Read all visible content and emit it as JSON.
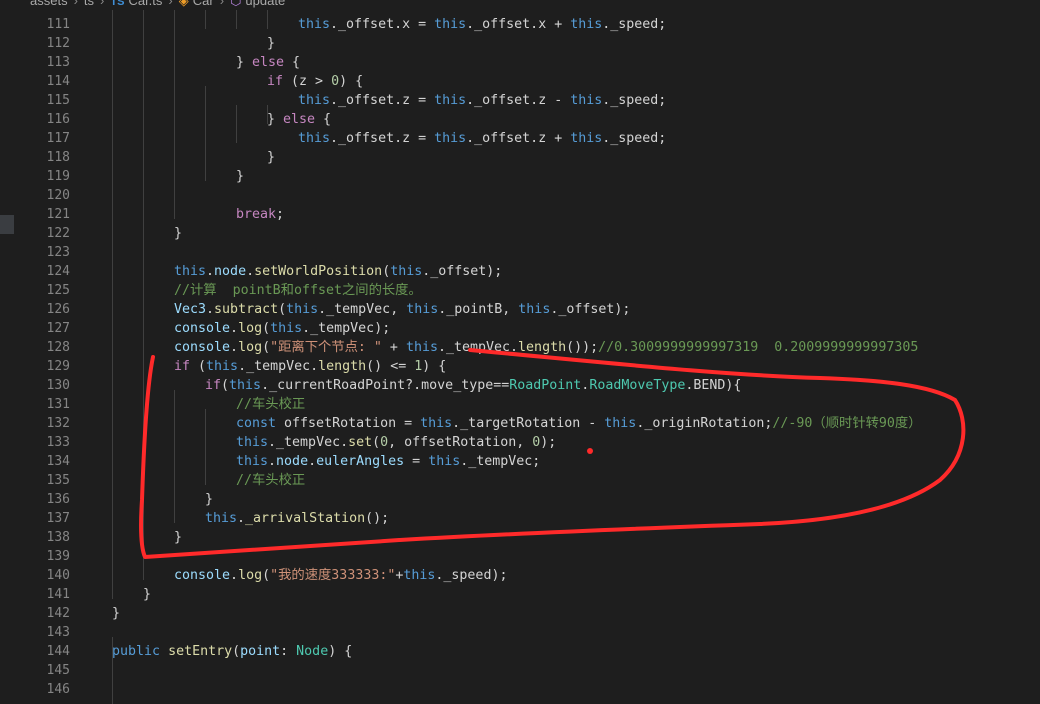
{
  "breadcrumb": {
    "items": [
      "assets",
      "ts",
      "Car.ts",
      "Car",
      "update"
    ],
    "file_badge": "TS"
  },
  "line_numbers": [
    "111",
    "112",
    "113",
    "114",
    "115",
    "116",
    "117",
    "118",
    "119",
    "120",
    "121",
    "122",
    "123",
    "124",
    "125",
    "126",
    "127",
    "128",
    "129",
    "130",
    "131",
    "132",
    "133",
    "134",
    "135",
    "136",
    "137",
    "138",
    "139",
    "140",
    "141",
    "142",
    "143",
    "144",
    "145",
    "146"
  ],
  "code_lines": [
    [
      [
        "p",
        "this"
      ],
      [
        "t",
        "._offset.x = "
      ],
      [
        "p",
        "this"
      ],
      [
        "t",
        "._offset.x + "
      ],
      [
        "p",
        "this"
      ],
      [
        "t",
        "._speed;"
      ]
    ],
    [
      [
        "t",
        "}"
      ]
    ],
    [
      [
        "t",
        "} "
      ],
      [
        "c",
        "else"
      ],
      [
        "t",
        " {"
      ]
    ],
    [
      [
        "c",
        "if"
      ],
      [
        "t",
        " (z > "
      ],
      [
        "n",
        "0"
      ],
      [
        "t",
        ") {"
      ]
    ],
    [
      [
        "p",
        "this"
      ],
      [
        "t",
        "._offset.z = "
      ],
      [
        "p",
        "this"
      ],
      [
        "t",
        "._offset.z - "
      ],
      [
        "p",
        "this"
      ],
      [
        "t",
        "._speed;"
      ]
    ],
    [
      [
        "t",
        "} "
      ],
      [
        "c",
        "else"
      ],
      [
        "t",
        " {"
      ]
    ],
    [
      [
        "p",
        "this"
      ],
      [
        "t",
        "._offset.z = "
      ],
      [
        "p",
        "this"
      ],
      [
        "t",
        "._offset.z + "
      ],
      [
        "p",
        "this"
      ],
      [
        "t",
        "._speed;"
      ]
    ],
    [
      [
        "t",
        "}"
      ]
    ],
    [
      [
        "t",
        "}"
      ]
    ],
    [],
    [
      [
        "c",
        "break"
      ],
      [
        "t",
        ";"
      ]
    ],
    [
      [
        "t",
        "}"
      ]
    ],
    [],
    [
      [
        "p",
        "this"
      ],
      [
        "t",
        "."
      ],
      [
        "v",
        "node"
      ],
      [
        "t",
        "."
      ],
      [
        "f",
        "setWorldPosition"
      ],
      [
        "t",
        "("
      ],
      [
        "p",
        "this"
      ],
      [
        "t",
        "._offset);"
      ]
    ],
    [
      [
        "m",
        "//计算  pointB和offset之间的长度。"
      ]
    ],
    [
      [
        "v",
        "Vec3"
      ],
      [
        "t",
        "."
      ],
      [
        "f",
        "subtract"
      ],
      [
        "t",
        "("
      ],
      [
        "p",
        "this"
      ],
      [
        "t",
        "._tempVec, "
      ],
      [
        "p",
        "this"
      ],
      [
        "t",
        "._pointB, "
      ],
      [
        "p",
        "this"
      ],
      [
        "t",
        "._offset);"
      ]
    ],
    [
      [
        "v",
        "console"
      ],
      [
        "t",
        "."
      ],
      [
        "f",
        "log"
      ],
      [
        "t",
        "("
      ],
      [
        "p",
        "this"
      ],
      [
        "t",
        "._tempVec);"
      ]
    ],
    [
      [
        "v",
        "console"
      ],
      [
        "t",
        "."
      ],
      [
        "f",
        "log"
      ],
      [
        "t",
        "("
      ],
      [
        "s",
        "\"距离下个节点: \""
      ],
      [
        "t",
        " + "
      ],
      [
        "p",
        "this"
      ],
      [
        "t",
        "._tempVec."
      ],
      [
        "f",
        "length"
      ],
      [
        "t",
        "());"
      ],
      [
        "m",
        "//0.3009999999997319  0.2009999999997305"
      ]
    ],
    [
      [
        "c",
        "if"
      ],
      [
        "t",
        " ("
      ],
      [
        "p",
        "this"
      ],
      [
        "t",
        "._tempVec."
      ],
      [
        "f",
        "length"
      ],
      [
        "t",
        "() <= "
      ],
      [
        "n",
        "1"
      ],
      [
        "t",
        ") {"
      ]
    ],
    [
      [
        "c",
        "if"
      ],
      [
        "t",
        "("
      ],
      [
        "p",
        "this"
      ],
      [
        "t",
        "._currentRoadPoint?.move_type=="
      ],
      [
        "y",
        "RoadPoint"
      ],
      [
        "t",
        "."
      ],
      [
        "y",
        "RoadMoveType"
      ],
      [
        "t",
        ".BEND){"
      ]
    ],
    [
      [
        "m",
        "//车头校正"
      ]
    ],
    [
      [
        "p",
        "const"
      ],
      [
        "t",
        " offsetRotation = "
      ],
      [
        "p",
        "this"
      ],
      [
        "t",
        "._targetRotation - "
      ],
      [
        "p",
        "this"
      ],
      [
        "t",
        "._originRotation;"
      ],
      [
        "m",
        "//-90（顺时针转90度）"
      ]
    ],
    [
      [
        "p",
        "this"
      ],
      [
        "t",
        "._tempVec."
      ],
      [
        "f",
        "set"
      ],
      [
        "t",
        "("
      ],
      [
        "n",
        "0"
      ],
      [
        "t",
        ", offsetRotation, "
      ],
      [
        "n",
        "0"
      ],
      [
        "t",
        ");"
      ]
    ],
    [
      [
        "p",
        "this"
      ],
      [
        "t",
        "."
      ],
      [
        "v",
        "node"
      ],
      [
        "t",
        "."
      ],
      [
        "v",
        "eulerAngles"
      ],
      [
        "t",
        " = "
      ],
      [
        "p",
        "this"
      ],
      [
        "t",
        "._tempVec;"
      ]
    ],
    [
      [
        "m",
        "//车头校正"
      ]
    ],
    [
      [
        "t",
        "}"
      ]
    ],
    [
      [
        "p",
        "this"
      ],
      [
        "t",
        "."
      ],
      [
        "f",
        "_arrivalStation"
      ],
      [
        "t",
        "();"
      ]
    ],
    [
      [
        "t",
        "}"
      ]
    ],
    [],
    [
      [
        "v",
        "console"
      ],
      [
        "t",
        "."
      ],
      [
        "f",
        "log"
      ],
      [
        "t",
        "("
      ],
      [
        "s",
        "\"我的速度333333:\""
      ],
      [
        "t",
        "+"
      ],
      [
        "p",
        "this"
      ],
      [
        "t",
        "._speed);"
      ]
    ],
    [
      [
        "t",
        "}"
      ]
    ],
    [
      [
        "t",
        "}"
      ]
    ],
    [],
    [
      [
        "p",
        "public"
      ],
      [
        "t",
        " "
      ],
      [
        "f",
        "setEntry"
      ],
      [
        "t",
        "("
      ],
      [
        "v",
        "point"
      ],
      [
        "t",
        ": "
      ],
      [
        "y",
        "Node"
      ],
      [
        "t",
        ") {"
      ]
    ],
    [],
    []
  ],
  "annotation_color": "#ff2a2a"
}
